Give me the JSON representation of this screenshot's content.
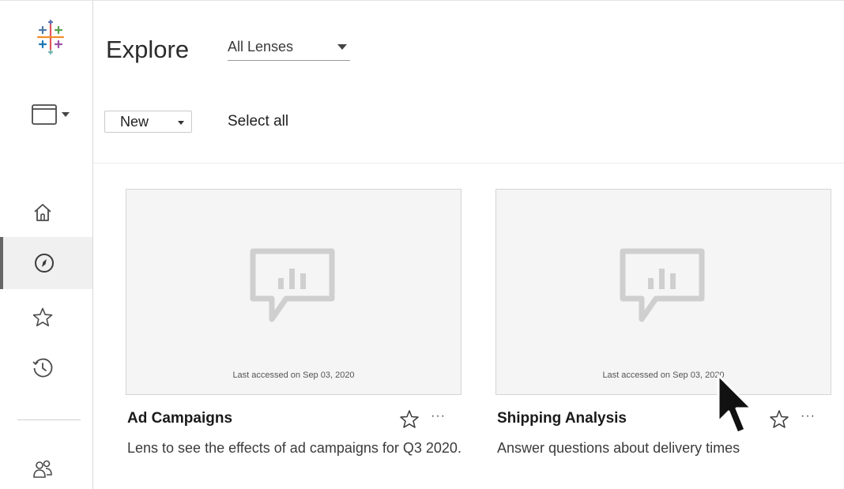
{
  "header": {
    "title": "Explore",
    "lens_filter": "All Lenses"
  },
  "toolbar": {
    "new_label": "New",
    "select_all_label": "Select all"
  },
  "sidebar": {
    "items": [
      {
        "name": "home",
        "icon": "home-icon"
      },
      {
        "name": "explore",
        "icon": "compass-icon",
        "active": true
      },
      {
        "name": "favorites",
        "icon": "star-icon"
      },
      {
        "name": "recents",
        "icon": "clock-icon"
      },
      {
        "name": "users",
        "icon": "users-icon"
      }
    ]
  },
  "cards": [
    {
      "title": "Ad Campaigns",
      "accessed": "Last accessed on Sep 03, 2020",
      "description": "Lens to see the effects of ad campaigns for Q3 2020.",
      "more": "···"
    },
    {
      "title": "Shipping Analysis",
      "accessed": "Last accessed on Sep 03, 2020",
      "description": "Answer questions about delivery times",
      "more": "···"
    }
  ],
  "colors": {
    "logo_blue": "#1f77b4",
    "logo_orange": "#f28e2b",
    "logo_red": "#e15759",
    "logo_teal": "#4e79a7",
    "thumb_bg": "#f5f5f5",
    "active_nav_bg": "#f0f0f0"
  }
}
